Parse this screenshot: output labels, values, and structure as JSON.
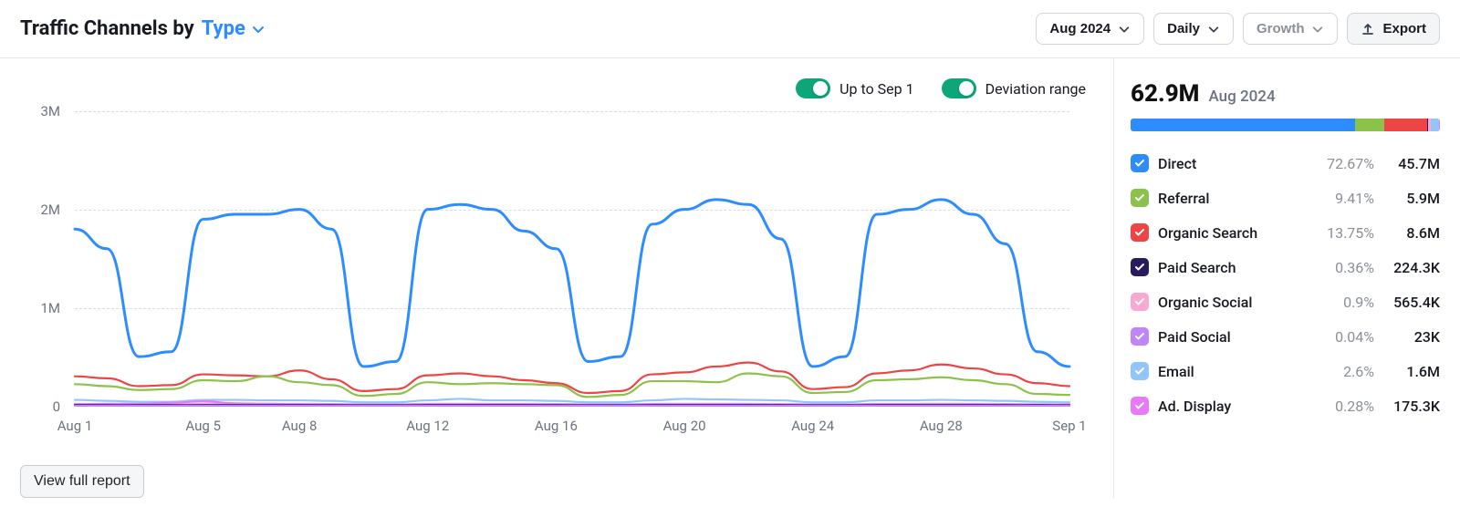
{
  "header": {
    "title_prefix": "Traffic Channels by",
    "title_type": "Type",
    "period": "Aug 2024",
    "granularity": "Daily",
    "metric": "Growth",
    "export": "Export"
  },
  "toggles": {
    "upto": "Up to Sep 1",
    "deviation": "Deviation range"
  },
  "summary": {
    "total": "62.9M",
    "period": "Aug 2024"
  },
  "channels": [
    {
      "key": "direct",
      "label": "Direct",
      "pct": "72.67%",
      "value": "45.7M",
      "pct_num": 72.67,
      "color": "#2d8cff"
    },
    {
      "key": "referral",
      "label": "Referral",
      "pct": "9.41%",
      "value": "5.9M",
      "pct_num": 9.41,
      "color": "#8bc34a"
    },
    {
      "key": "organic_search",
      "label": "Organic Search",
      "pct": "13.75%",
      "value": "8.6M",
      "pct_num": 13.75,
      "color": "#ef4444"
    },
    {
      "key": "paid_search",
      "label": "Paid Search",
      "pct": "0.36%",
      "value": "224.3K",
      "pct_num": 0.36,
      "color": "#2a1a5e"
    },
    {
      "key": "organic_social",
      "label": "Organic Social",
      "pct": "0.9%",
      "value": "565.4K",
      "pct_num": 0.9,
      "color": "#f9a8d4"
    },
    {
      "key": "paid_social",
      "label": "Paid Social",
      "pct": "0.04%",
      "value": "23K",
      "pct_num": 0.04,
      "color": "#c084fc"
    },
    {
      "key": "email",
      "label": "Email",
      "pct": "2.6%",
      "value": "1.6M",
      "pct_num": 2.6,
      "color": "#93c5fd"
    },
    {
      "key": "ad_display",
      "label": "Ad. Display",
      "pct": "0.28%",
      "value": "175.3K",
      "pct_num": 0.28,
      "color": "#e879f9"
    }
  ],
  "chart_data": {
    "type": "line",
    "xlabel": "",
    "ylabel": "",
    "ylim": [
      0,
      3000000
    ],
    "y_ticks": [
      {
        "v": 0,
        "label": "0"
      },
      {
        "v": 1000000,
        "label": "1M"
      },
      {
        "v": 2000000,
        "label": "2M"
      },
      {
        "v": 3000000,
        "label": "3M"
      }
    ],
    "categories": [
      "Aug 1",
      "Aug 2",
      "Aug 3",
      "Aug 4",
      "Aug 5",
      "Aug 6",
      "Aug 7",
      "Aug 8",
      "Aug 9",
      "Aug 10",
      "Aug 11",
      "Aug 12",
      "Aug 13",
      "Aug 14",
      "Aug 15",
      "Aug 16",
      "Aug 17",
      "Aug 18",
      "Aug 19",
      "Aug 20",
      "Aug 21",
      "Aug 22",
      "Aug 23",
      "Aug 24",
      "Aug 25",
      "Aug 26",
      "Aug 27",
      "Aug 28",
      "Aug 29",
      "Aug 30",
      "Aug 31",
      "Sep 1"
    ],
    "x_tick_labels": [
      "Aug 1",
      "Aug 5",
      "Aug 8",
      "Aug 12",
      "Aug 16",
      "Aug 20",
      "Aug 24",
      "Aug 28",
      "Sep 1"
    ],
    "x_tick_idx": [
      0,
      4,
      7,
      11,
      15,
      19,
      23,
      27,
      31
    ],
    "series": [
      {
        "name": "Direct",
        "color": "#2d8cff",
        "values": [
          1800000,
          1600000,
          500000,
          550000,
          1900000,
          1950000,
          1950000,
          2000000,
          1800000,
          400000,
          450000,
          2000000,
          2050000,
          2000000,
          1780000,
          1600000,
          450000,
          500000,
          1850000,
          2000000,
          2100000,
          2050000,
          1700000,
          400000,
          500000,
          1950000,
          2000000,
          2100000,
          1950000,
          1650000,
          550000,
          400000
        ]
      },
      {
        "name": "Organic Search",
        "color": "#ef4444",
        "values": [
          300000,
          280000,
          200000,
          210000,
          320000,
          310000,
          300000,
          360000,
          270000,
          150000,
          170000,
          310000,
          330000,
          300000,
          260000,
          230000,
          130000,
          150000,
          320000,
          340000,
          400000,
          440000,
          350000,
          170000,
          190000,
          330000,
          360000,
          420000,
          380000,
          320000,
          230000,
          200000
        ]
      },
      {
        "name": "Referral",
        "color": "#8bc34a",
        "values": [
          220000,
          200000,
          160000,
          170000,
          260000,
          250000,
          300000,
          240000,
          210000,
          100000,
          120000,
          240000,
          220000,
          230000,
          220000,
          210000,
          90000,
          110000,
          250000,
          250000,
          240000,
          330000,
          300000,
          130000,
          140000,
          260000,
          270000,
          290000,
          260000,
          220000,
          120000,
          110000
        ]
      },
      {
        "name": "Email",
        "color": "#93c5fd",
        "values": [
          60000,
          50000,
          40000,
          40000,
          60000,
          60000,
          55000,
          55000,
          50000,
          35000,
          35000,
          55000,
          70000,
          55000,
          55000,
          50000,
          35000,
          35000,
          55000,
          70000,
          65000,
          60000,
          55000,
          35000,
          35000,
          55000,
          55000,
          60000,
          55000,
          50000,
          40000,
          35000
        ]
      },
      {
        "name": "Organic Social",
        "color": "#f9a8d4",
        "values": [
          20000,
          18000,
          15000,
          15000,
          20000,
          20000,
          20000,
          20000,
          18000,
          14000,
          14000,
          20000,
          20000,
          20000,
          20000,
          18000,
          14000,
          14000,
          20000,
          20000,
          20000,
          20000,
          18000,
          14000,
          14000,
          20000,
          20000,
          20000,
          20000,
          18000,
          15000,
          14000
        ]
      },
      {
        "name": "Ad. Display",
        "color": "#e879f9",
        "values": [
          15000,
          20000,
          20000,
          30000,
          45000,
          25000,
          20000,
          15000,
          12000,
          12000,
          12000,
          15000,
          15000,
          15000,
          15000,
          12000,
          12000,
          12000,
          15000,
          15000,
          15000,
          15000,
          12000,
          12000,
          12000,
          15000,
          15000,
          15000,
          15000,
          12000,
          12000,
          12000
        ]
      },
      {
        "name": "Paid Search",
        "color": "#2a1a5e",
        "values": [
          8000,
          8000,
          7000,
          7000,
          8000,
          8000,
          8000,
          8000,
          8000,
          6000,
          6000,
          8000,
          8000,
          8000,
          8000,
          8000,
          6000,
          6000,
          8000,
          8000,
          8000,
          8000,
          8000,
          6000,
          6000,
          8000,
          8000,
          8000,
          8000,
          8000,
          7000,
          6000
        ]
      },
      {
        "name": "Paid Social",
        "color": "#c084fc",
        "values": [
          1000,
          1000,
          800,
          800,
          1000,
          1000,
          1000,
          1000,
          1000,
          700,
          700,
          1000,
          1000,
          1000,
          1000,
          1000,
          700,
          700,
          1000,
          1000,
          1000,
          1000,
          1000,
          700,
          700,
          1000,
          1000,
          1000,
          1000,
          1000,
          800,
          700
        ]
      }
    ]
  },
  "view_report": "View full report"
}
